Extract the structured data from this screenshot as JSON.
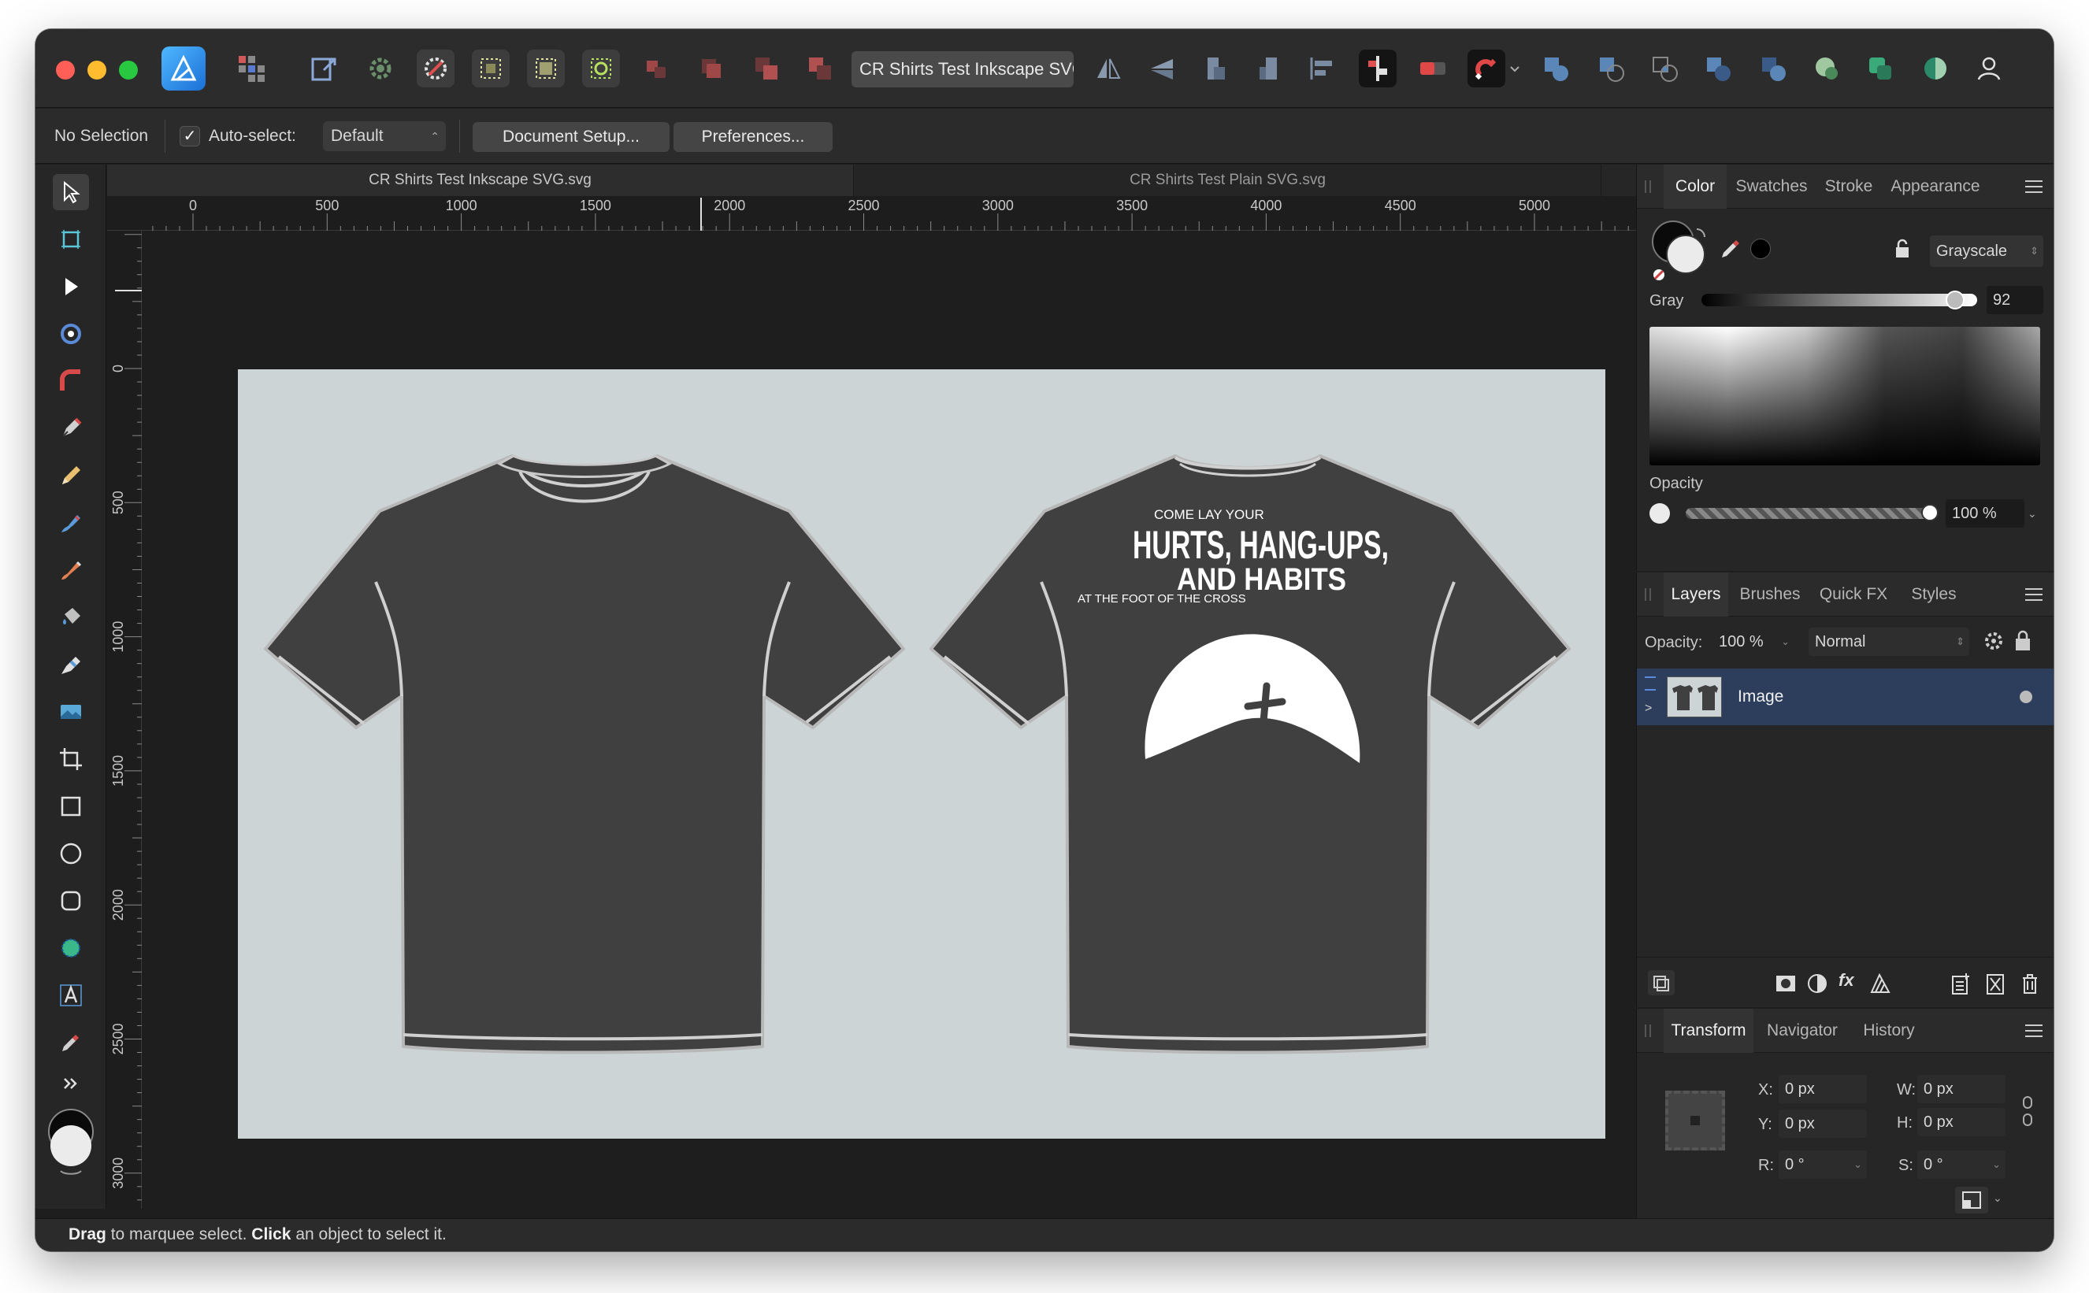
{
  "window": {
    "document_field": "CR Shirts Test Inkscape SVG"
  },
  "context_bar": {
    "selection": "No Selection",
    "auto_select_label": "Auto-select:",
    "auto_select_checked": true,
    "auto_select_value": "Default",
    "document_setup": "Document Setup...",
    "preferences": "Preferences..."
  },
  "doc_tabs": [
    "CR Shirts Test Inkscape SVG.svg",
    "CR Shirts Test Plain SVG.svg"
  ],
  "ruler": {
    "unit": "px",
    "h_labels": [
      "0",
      "500",
      "1000",
      "1500",
      "2000",
      "2500",
      "3000",
      "3500",
      "4000",
      "4500",
      "5000"
    ],
    "v_labels": [
      "0",
      "500",
      "1000",
      "1500",
      "2000",
      "2500",
      "3000"
    ]
  },
  "artboard": {
    "background": "#cdd4d5",
    "shirt_color": "#404040",
    "print": {
      "line1": "COME LAY YOUR",
      "line2": "HURTS, HANG-UPS,",
      "line3": "AND HABITS",
      "line4": "AT THE FOOT OF THE CROSS"
    }
  },
  "color_panel": {
    "tabs": [
      "Color",
      "Swatches",
      "Stroke",
      "Appearance"
    ],
    "active_tab": "Color",
    "model": "Grayscale",
    "gray_label": "Gray",
    "gray_value": "92",
    "opacity_label": "Opacity",
    "opacity_value": "100 %"
  },
  "layers_panel": {
    "tabs": [
      "Layers",
      "Brushes",
      "Quick FX",
      "Styles"
    ],
    "active_tab": "Layers",
    "opacity_label": "Opacity:",
    "opacity_value": "100 %",
    "blend_mode": "Normal",
    "layers": [
      {
        "name": "Image"
      }
    ]
  },
  "transform_panel": {
    "tabs": [
      "Transform",
      "Navigator",
      "History"
    ],
    "active_tab": "Transform",
    "x_label": "X:",
    "x": "0 px",
    "y_label": "Y:",
    "y": "0 px",
    "w_label": "W:",
    "w": "0 px",
    "h_label": "H:",
    "h": "0 px",
    "r_label": "R:",
    "r": "0 °",
    "s_label": "S:",
    "s": "0 °"
  },
  "status": {
    "drag": "Drag",
    "drag_text": " to marquee select. ",
    "click": "Click",
    "click_text": " an object to select it."
  }
}
